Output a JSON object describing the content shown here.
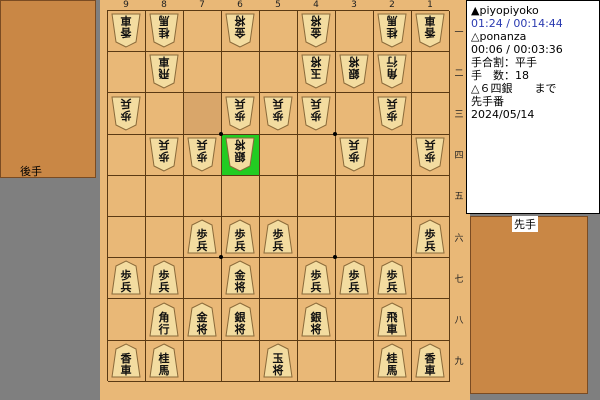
{
  "board_state": {
    "files": [
      "9",
      "8",
      "7",
      "6",
      "5",
      "4",
      "3",
      "2",
      "1"
    ],
    "ranks": [
      "一",
      "二",
      "三",
      "四",
      "五",
      "六",
      "七",
      "八",
      "九"
    ],
    "highlight": {
      "file": 6,
      "rank": 4
    },
    "pieces": [
      {
        "file": 9,
        "rank": 1,
        "side": "gote",
        "glyph": [
          "香",
          "車"
        ]
      },
      {
        "file": 8,
        "rank": 1,
        "side": "gote",
        "glyph": [
          "桂",
          "馬"
        ]
      },
      {
        "file": 6,
        "rank": 1,
        "side": "gote",
        "glyph": [
          "金",
          "将"
        ]
      },
      {
        "file": 4,
        "rank": 1,
        "side": "gote",
        "glyph": [
          "金",
          "将"
        ]
      },
      {
        "file": 2,
        "rank": 1,
        "side": "gote",
        "glyph": [
          "桂",
          "馬"
        ]
      },
      {
        "file": 1,
        "rank": 1,
        "side": "gote",
        "glyph": [
          "香",
          "車"
        ]
      },
      {
        "file": 8,
        "rank": 2,
        "side": "gote",
        "glyph": [
          "飛",
          "車"
        ]
      },
      {
        "file": 4,
        "rank": 2,
        "side": "gote",
        "glyph": [
          "玉",
          "将"
        ]
      },
      {
        "file": 3,
        "rank": 2,
        "side": "gote",
        "glyph": [
          "銀",
          "将"
        ]
      },
      {
        "file": 2,
        "rank": 2,
        "side": "gote",
        "glyph": [
          "角",
          "行"
        ]
      },
      {
        "file": 9,
        "rank": 3,
        "side": "gote",
        "glyph": [
          "歩",
          "兵"
        ]
      },
      {
        "file": 6,
        "rank": 3,
        "side": "gote",
        "glyph": [
          "歩",
          "兵"
        ]
      },
      {
        "file": 5,
        "rank": 3,
        "side": "gote",
        "glyph": [
          "歩",
          "兵"
        ]
      },
      {
        "file": 4,
        "rank": 3,
        "side": "gote",
        "glyph": [
          "歩",
          "兵"
        ]
      },
      {
        "file": 2,
        "rank": 3,
        "side": "gote",
        "glyph": [
          "歩",
          "兵"
        ]
      },
      {
        "file": 8,
        "rank": 4,
        "side": "gote",
        "glyph": [
          "歩",
          "兵"
        ]
      },
      {
        "file": 7,
        "rank": 4,
        "side": "gote",
        "glyph": [
          "歩",
          "兵"
        ]
      },
      {
        "file": 6,
        "rank": 4,
        "side": "gote",
        "glyph": [
          "銀",
          "将"
        ]
      },
      {
        "file": 3,
        "rank": 4,
        "side": "gote",
        "glyph": [
          "歩",
          "兵"
        ]
      },
      {
        "file": 1,
        "rank": 4,
        "side": "gote",
        "glyph": [
          "歩",
          "兵"
        ]
      },
      {
        "file": 7,
        "rank": 6,
        "side": "sente",
        "glyph": [
          "歩",
          "兵"
        ]
      },
      {
        "file": 6,
        "rank": 6,
        "side": "sente",
        "glyph": [
          "歩",
          "兵"
        ]
      },
      {
        "file": 5,
        "rank": 6,
        "side": "sente",
        "glyph": [
          "歩",
          "兵"
        ]
      },
      {
        "file": 1,
        "rank": 6,
        "side": "sente",
        "glyph": [
          "歩",
          "兵"
        ]
      },
      {
        "file": 9,
        "rank": 7,
        "side": "sente",
        "glyph": [
          "歩",
          "兵"
        ]
      },
      {
        "file": 8,
        "rank": 7,
        "side": "sente",
        "glyph": [
          "歩",
          "兵"
        ]
      },
      {
        "file": 6,
        "rank": 7,
        "side": "sente",
        "glyph": [
          "金",
          "将"
        ]
      },
      {
        "file": 4,
        "rank": 7,
        "side": "sente",
        "glyph": [
          "歩",
          "兵"
        ]
      },
      {
        "file": 3,
        "rank": 7,
        "side": "sente",
        "glyph": [
          "歩",
          "兵"
        ]
      },
      {
        "file": 2,
        "rank": 7,
        "side": "sente",
        "glyph": [
          "歩",
          "兵"
        ]
      },
      {
        "file": 8,
        "rank": 8,
        "side": "sente",
        "glyph": [
          "角",
          "行"
        ]
      },
      {
        "file": 7,
        "rank": 8,
        "side": "sente",
        "glyph": [
          "金",
          "将"
        ]
      },
      {
        "file": 6,
        "rank": 8,
        "side": "sente",
        "glyph": [
          "銀",
          "将"
        ]
      },
      {
        "file": 4,
        "rank": 8,
        "side": "sente",
        "glyph": [
          "銀",
          "将"
        ]
      },
      {
        "file": 2,
        "rank": 8,
        "side": "sente",
        "glyph": [
          "飛",
          "車"
        ]
      },
      {
        "file": 9,
        "rank": 9,
        "side": "sente",
        "glyph": [
          "香",
          "車"
        ]
      },
      {
        "file": 8,
        "rank": 9,
        "side": "sente",
        "glyph": [
          "桂",
          "馬"
        ]
      },
      {
        "file": 5,
        "rank": 9,
        "side": "sente",
        "glyph": [
          "玉",
          "将"
        ]
      },
      {
        "file": 2,
        "rank": 9,
        "side": "sente",
        "glyph": [
          "桂",
          "馬"
        ]
      },
      {
        "file": 1,
        "rank": 9,
        "side": "sente",
        "glyph": [
          "香",
          "車"
        ]
      }
    ]
  },
  "stands": {
    "gote_label": "後手",
    "sente_label": "先手"
  },
  "info": {
    "sente_name": "▲piyopiyoko",
    "sente_time": "01:24 / 00:14:44",
    "gote_name": "△ponanza",
    "gote_time": "00:06 / 00:03:36",
    "handicap": "手合割：平手",
    "move_count": "手　数：18",
    "last_move": "△６四銀　　まで",
    "turn": "先手番",
    "date": "2024/05/14"
  },
  "colors": {
    "board": "#e9b877",
    "stand": "#c98745",
    "highlight": "#22cc22",
    "piece_face": "#f3dca0"
  }
}
